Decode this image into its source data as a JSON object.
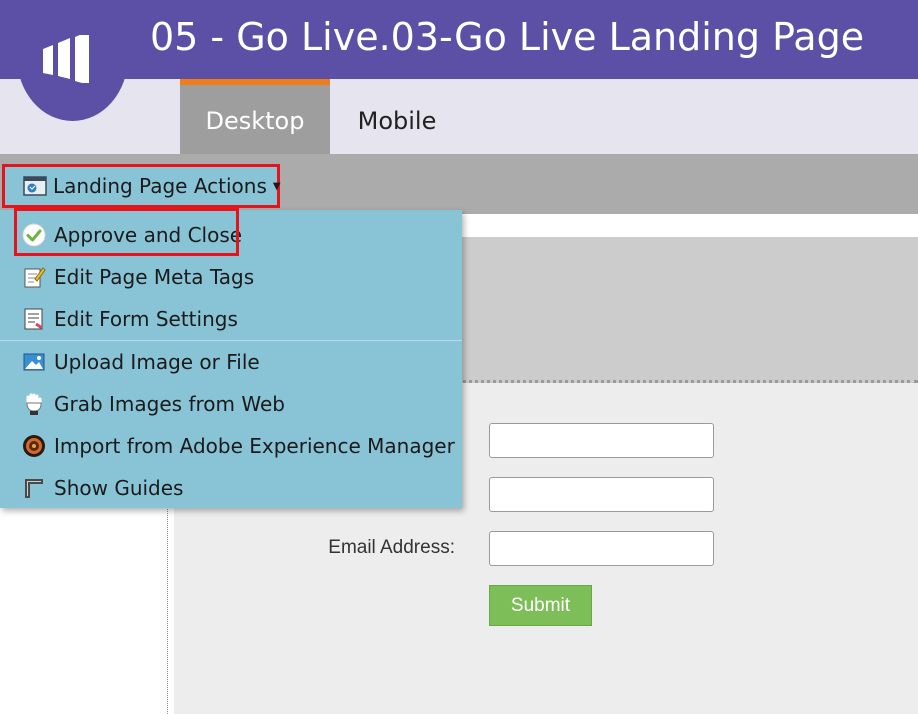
{
  "header": {
    "title": "05 - Go Live.03-Go Live Landing Page",
    "bg": "#5b4fa6"
  },
  "tabs": [
    {
      "label": "Desktop",
      "active": true,
      "accent": "#f07d1b"
    },
    {
      "label": "Mobile",
      "active": false
    }
  ],
  "toolbar": {
    "actions_label": "Landing Page Actions",
    "actions_icon": "landing-page-icon"
  },
  "menu": {
    "items": [
      {
        "label": "Approve and Close",
        "icon": "check-circle-icon"
      },
      {
        "label": "Edit Page Meta Tags",
        "icon": "meta-tags-icon"
      },
      {
        "label": "Edit Form Settings",
        "icon": "form-settings-icon"
      },
      {
        "label": "Upload Image or File",
        "icon": "image-upload-icon"
      },
      {
        "label": "Grab Images from Web",
        "icon": "grab-hand-icon"
      },
      {
        "label": "Import from Adobe Experience Manager",
        "icon": "adobe-aem-icon"
      },
      {
        "label": "Show Guides",
        "icon": "guides-icon"
      }
    ]
  },
  "form": {
    "fields": [
      {
        "label": "",
        "value": ""
      },
      {
        "label": "",
        "value": ""
      },
      {
        "label": "Email Address:",
        "value": ""
      }
    ],
    "submit_label": "Submit"
  },
  "colors": {
    "highlight": "#e3141b",
    "menu_bg": "#89c3d6",
    "submit_bg": "#7ebe58"
  }
}
